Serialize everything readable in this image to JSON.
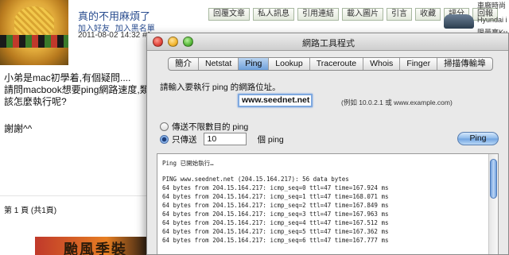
{
  "forum": {
    "username": "真的不用麻煩了",
    "links": [
      "加入好友",
      "加入黑名單"
    ],
    "date": "2011-08-02 14:32 #1",
    "toolbar": [
      "回覆文章",
      "私人訊息",
      "引用連結",
      "載入圖片",
      "引言",
      "收藏",
      "評分",
      "回報"
    ],
    "ad": {
      "line1": "車廠時尚",
      "line2": "Hyundai i",
      "line3": "限量享Ku"
    },
    "post_lines": [
      "小弟是mac初學着,有個疑問....",
      "請問macbook想要ping網路速度,類似",
      "該怎麼執行呢?"
    ],
    "thanks": "謝謝^^",
    "pager": "第 1 頁 (共1頁)",
    "banner": "颱風季裝"
  },
  "window": {
    "title": "網路工具程式",
    "tabs": [
      "簡介",
      "Netstat",
      "Ping",
      "Lookup",
      "Traceroute",
      "Whois",
      "Finger",
      "掃描傳輸埠"
    ],
    "active_tab": "Ping",
    "prompt": "請輸入要執行 ping 的網路位址。",
    "address": "www.seednet.net",
    "example": "(例如 10.0.2.1 或 www.example.com)",
    "option_unlimited": "傳送不限數目的 ping",
    "option_only": "只傳送",
    "count": "10",
    "count_unit": "個 ping",
    "ping_button": "Ping",
    "output_lines": [
      "Ping 已開始執行…",
      "",
      "PING www.seednet.net (204.15.164.217): 56 data bytes",
      "64 bytes from 204.15.164.217: icmp_seq=0 ttl=47 time=167.924 ms",
      "64 bytes from 204.15.164.217: icmp_seq=1 ttl=47 time=168.071 ms",
      "64 bytes from 204.15.164.217: icmp_seq=2 ttl=47 time=167.849 ms",
      "64 bytes from 204.15.164.217: icmp_seq=3 ttl=47 time=167.963 ms",
      "64 bytes from 204.15.164.217: icmp_seq=4 ttl=47 time=167.512 ms",
      "64 bytes from 204.15.164.217: icmp_seq=5 ttl=47 time=167.362 ms",
      "64 bytes from 204.15.164.217: icmp_seq=6 ttl=47 time=167.777 ms"
    ]
  }
}
